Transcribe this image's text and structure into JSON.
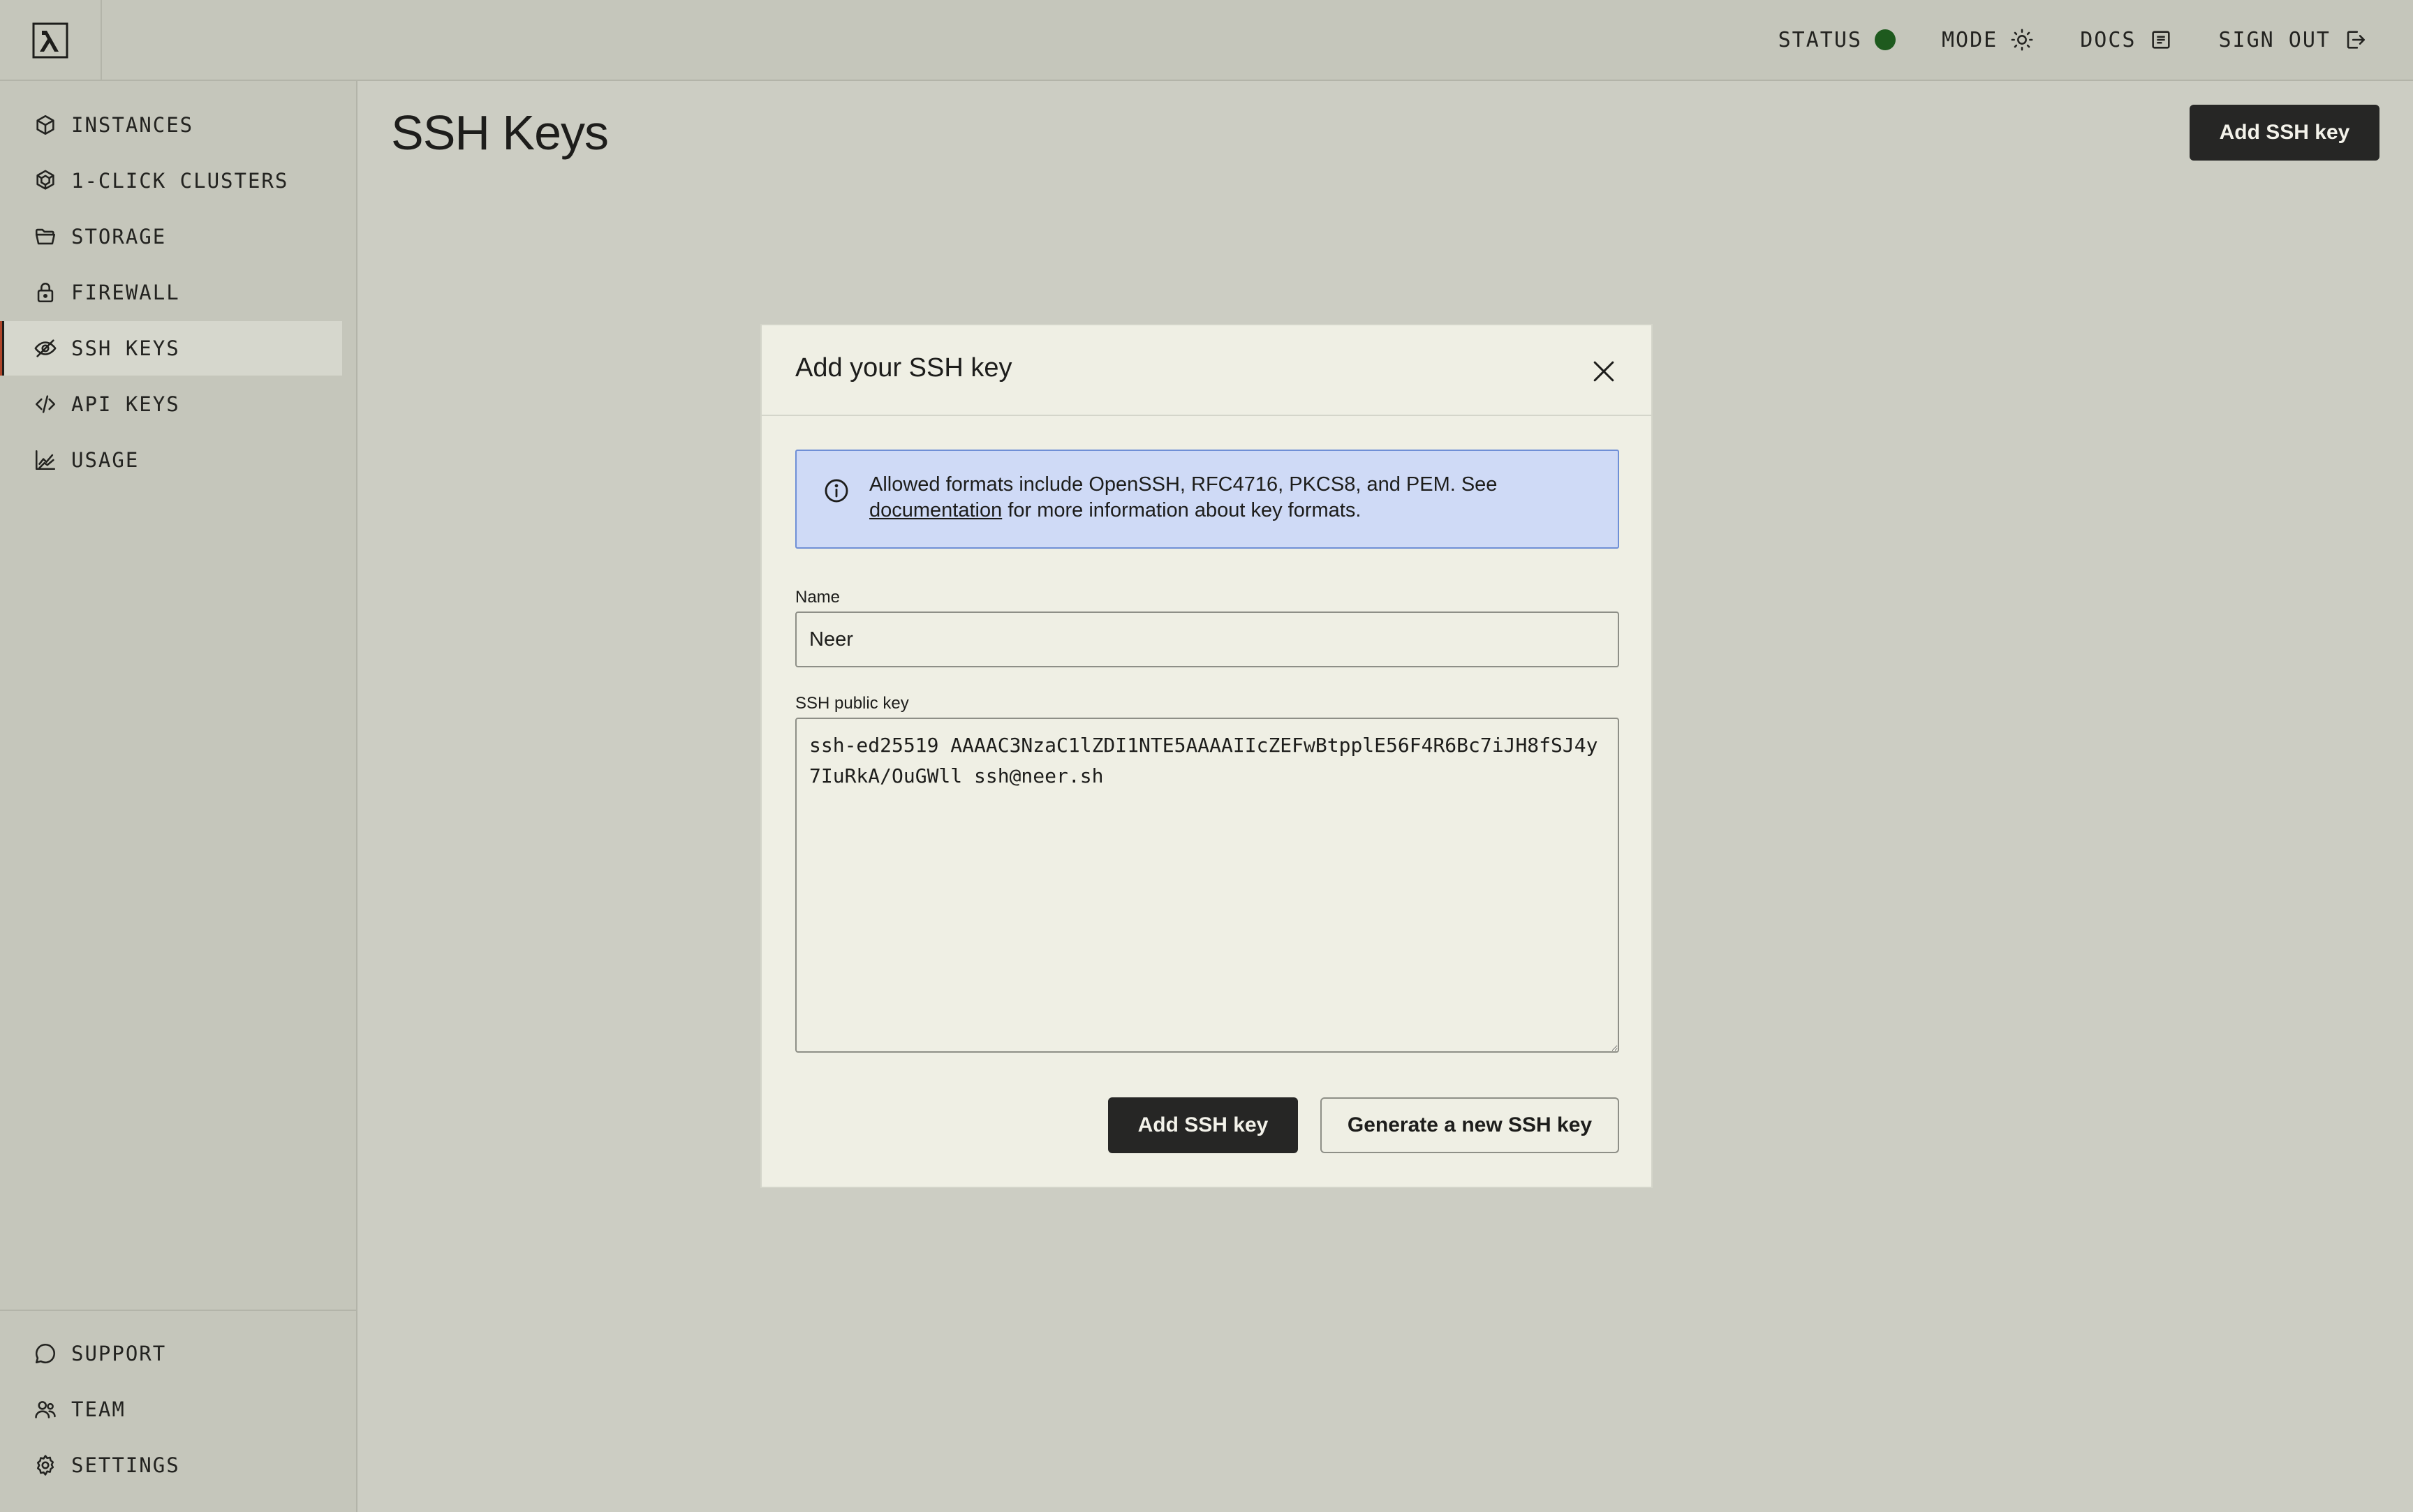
{
  "topbar": {
    "status_label": "STATUS",
    "mode_label": "MODE",
    "docs_label": "DOCS",
    "signout_label": "SIGN OUT",
    "status_color": "#1e5a1e"
  },
  "sidebar": {
    "items": [
      {
        "label": "INSTANCES",
        "icon": "cube-icon"
      },
      {
        "label": "1-CLICK CLUSTERS",
        "icon": "cluster-icon"
      },
      {
        "label": "STORAGE",
        "icon": "folder-icon"
      },
      {
        "label": "FIREWALL",
        "icon": "lock-icon"
      },
      {
        "label": "SSH KEYS",
        "icon": "key-icon",
        "active": true
      },
      {
        "label": "API KEYS",
        "icon": "code-icon"
      },
      {
        "label": "USAGE",
        "icon": "chart-icon"
      }
    ],
    "bottom_items": [
      {
        "label": "SUPPORT",
        "icon": "chat-icon"
      },
      {
        "label": "TEAM",
        "icon": "team-icon"
      },
      {
        "label": "SETTINGS",
        "icon": "gear-icon"
      }
    ]
  },
  "main": {
    "title": "SSH Keys",
    "add_button": "Add SSH key"
  },
  "modal": {
    "title": "Add your SSH key",
    "info_text_before": "Allowed formats include OpenSSH, RFC4716, PKCS8, and PEM. See",
    "info_link": "documentation",
    "info_text_after": "for more information about key formats.",
    "name_label": "Name",
    "name_value": "Neer",
    "key_label": "SSH public key",
    "key_value": "ssh-ed25519 AAAAC3NzaC1lZDI1NTE5AAAAIIcZEFwBtpplE56F4R6Bc7iJH8fSJ4y7IuRkA/OuGWll ssh@neer.sh",
    "add_button": "Add SSH key",
    "generate_button": "Generate a new SSH key"
  },
  "colors": {
    "background": "#cccdc3",
    "modal_bg": "#efefe4",
    "info_bg": "#cfdaf6",
    "info_border": "#6f8fd6",
    "dark_button": "#262625"
  }
}
